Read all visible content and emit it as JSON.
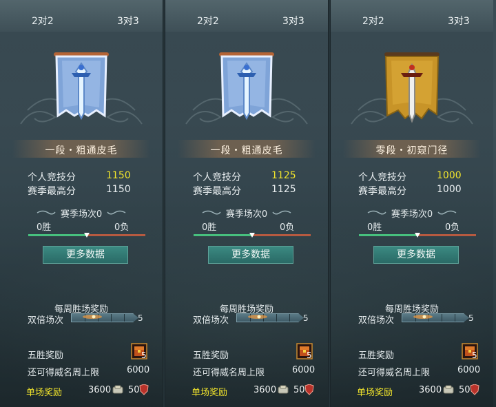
{
  "tabs": {
    "left": "2对2",
    "right": "3对3"
  },
  "colors": {
    "highlight": "#f1e42c",
    "win_bar": "#47c07e",
    "loss_bar": "#b65a40",
    "button": "#2f7872"
  },
  "panels": [
    {
      "emblem_icon": "blue-silver-sword-banner-icon",
      "rank_title": "一段・粗通皮毛",
      "personal_score_label": "个人竞技分",
      "personal_score": "1150",
      "season_high_label": "赛季最高分",
      "season_high": "1150",
      "season_matches": "赛季场次0",
      "wins": "0胜",
      "losses": "0负",
      "win_ratio": 0.5,
      "more_data_button": "更多数据",
      "weekly_reward_title": "每周胜场奖励",
      "double_matches_label": "双倍场次",
      "double_matches_total": "5",
      "double_progress": 0,
      "five_win_label": "五胜奖励",
      "chest_count": "5",
      "fame_cap_label": "还可得威名周上限",
      "fame_cap_value": "6000",
      "single_reward_label": "单场奖励",
      "coin_reward": "3600",
      "shield_reward": "50"
    },
    {
      "emblem_icon": "blue-silver-sword-banner-icon",
      "rank_title": "一段・粗通皮毛",
      "personal_score_label": "个人竞技分",
      "personal_score": "1125",
      "season_high_label": "赛季最高分",
      "season_high": "1125",
      "season_matches": "赛季场次0",
      "wins": "0胜",
      "losses": "0负",
      "win_ratio": 0.5,
      "more_data_button": "更多数据",
      "weekly_reward_title": "每周胜场奖励",
      "double_matches_label": "双倍场次",
      "double_matches_total": "5",
      "double_progress": 0,
      "five_win_label": "五胜奖励",
      "chest_count": "5",
      "fame_cap_label": "还可得威名周上限",
      "fame_cap_value": "6000",
      "single_reward_label": "单场奖励",
      "coin_reward": "3600",
      "shield_reward": "50"
    },
    {
      "emblem_icon": "gold-sword-banner-icon",
      "rank_title": "零段・初窥门径",
      "personal_score_label": "个人竞技分",
      "personal_score": "1000",
      "season_high_label": "赛季最高分",
      "season_high": "1000",
      "season_matches": "赛季场次0",
      "wins": "0胜",
      "losses": "0负",
      "win_ratio": 0.5,
      "more_data_button": "更多数据",
      "weekly_reward_title": "每周胜场奖励",
      "double_matches_label": "双倍场次",
      "double_matches_total": "5",
      "double_progress": 0,
      "five_win_label": "五胜奖励",
      "chest_count": "5",
      "fame_cap_label": "还可得威名周上限",
      "fame_cap_value": "6000",
      "single_reward_label": "单场奖励",
      "coin_reward": "3600",
      "shield_reward": "50"
    }
  ]
}
